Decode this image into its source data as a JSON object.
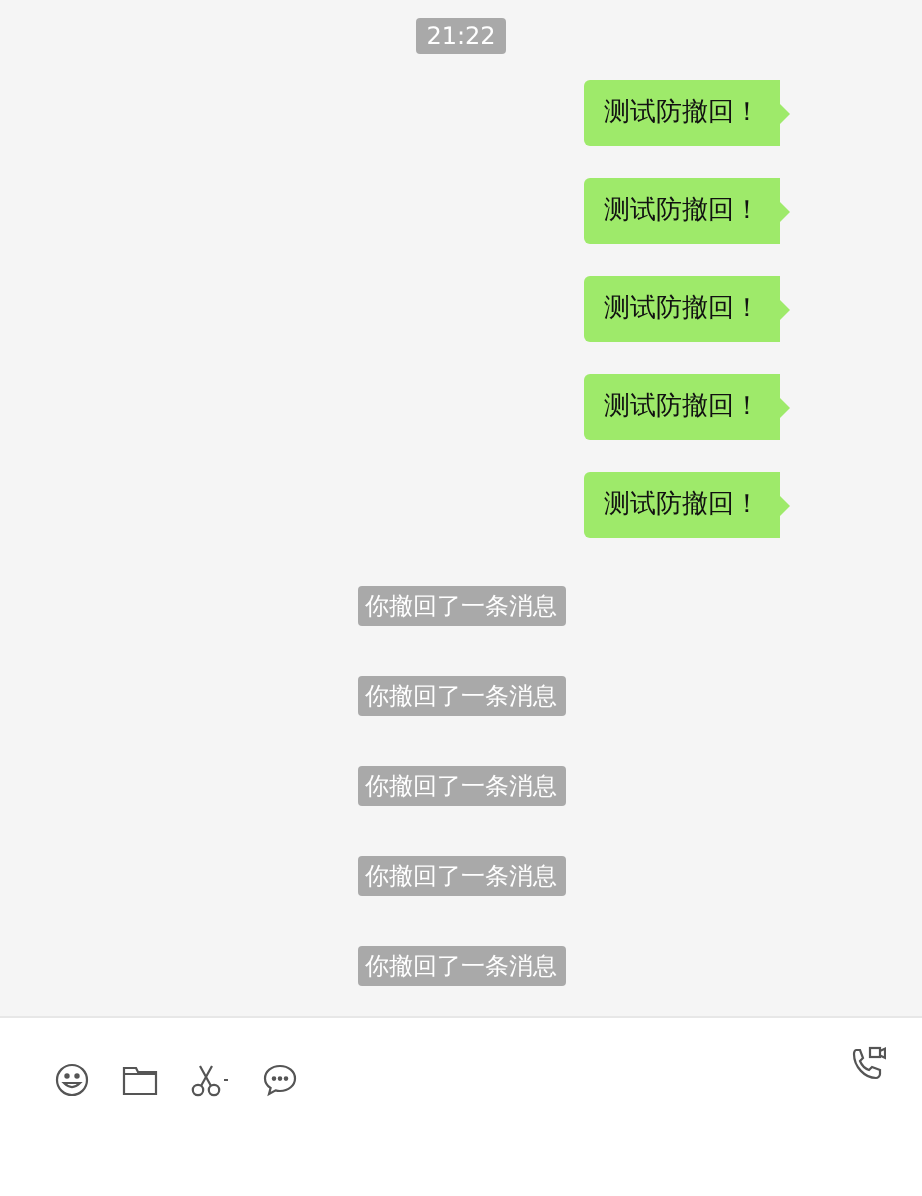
{
  "timestamp": "21:22",
  "messages": [
    {
      "kind": "sent",
      "text": "测试防撤回！"
    },
    {
      "kind": "sent",
      "text": "测试防撤回！"
    },
    {
      "kind": "sent",
      "text": "测试防撤回！"
    },
    {
      "kind": "sent",
      "text": "测试防撤回！"
    },
    {
      "kind": "sent",
      "text": "测试防撤回！"
    },
    {
      "kind": "recall",
      "text": "你撤回了一条消息"
    },
    {
      "kind": "recall",
      "text": "你撤回了一条消息"
    },
    {
      "kind": "recall",
      "text": "你撤回了一条消息"
    },
    {
      "kind": "recall",
      "text": "你撤回了一条消息"
    },
    {
      "kind": "recall",
      "text": "你撤回了一条消息"
    }
  ]
}
